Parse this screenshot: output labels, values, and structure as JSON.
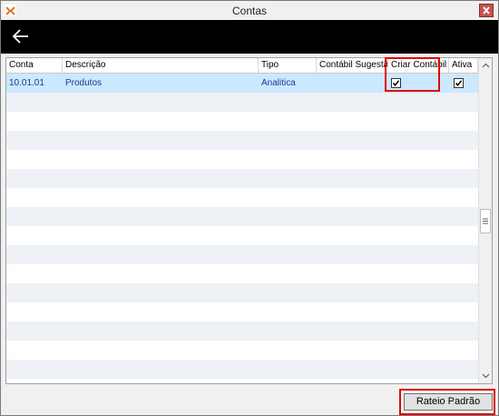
{
  "window": {
    "title": "Contas"
  },
  "grid": {
    "columns": [
      "Conta",
      "Descrição",
      "Tipo",
      "Contábil Sugestão",
      "Criar Contábil",
      "Ativa"
    ],
    "rows": [
      {
        "conta": "10.01.01",
        "descricao": "Produtos",
        "tipo": "Analitica",
        "contabil_sugestao": "",
        "criar_contabil": true,
        "ativa": true
      }
    ],
    "empty_rows": 15
  },
  "footer": {
    "rateio_label": "Rateio Padrão"
  },
  "colors": {
    "toolbar": "#000000",
    "selected_row": "#cce8ff",
    "highlight": "#e00000",
    "row_text": "#1a3b8c"
  },
  "icons": {
    "back": "arrow-left-icon",
    "app": "app-logo-icon",
    "close": "close-icon"
  }
}
